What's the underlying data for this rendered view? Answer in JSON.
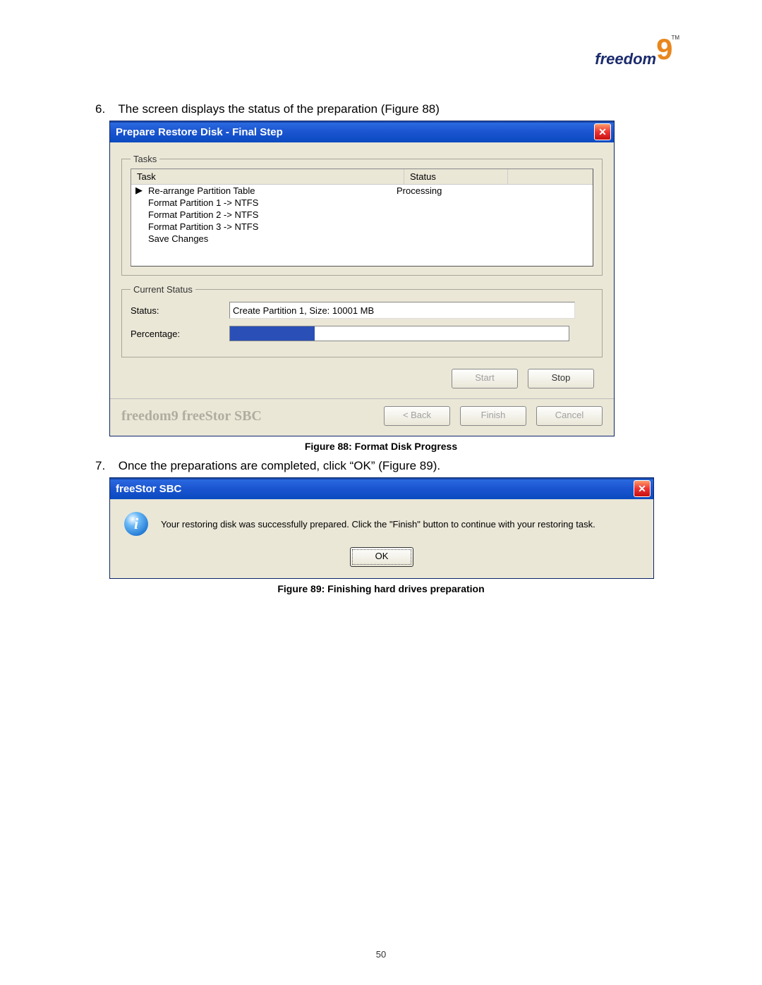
{
  "page_number": "50",
  "logo": {
    "text": "freedom",
    "nine": "9",
    "tm": "TM"
  },
  "step6": {
    "num": "6.",
    "text": "The screen displays the status of the preparation (Figure 88)"
  },
  "dialog1": {
    "title": "Prepare Restore Disk - Final Step",
    "tasks_legend": "Tasks",
    "header": {
      "task": "Task",
      "status": "Status"
    },
    "rows": [
      {
        "marker": "▶",
        "task": "Re-arrange Partition Table",
        "status": "Processing"
      },
      {
        "marker": "",
        "task": "Format Partition 1 -> NTFS",
        "status": ""
      },
      {
        "marker": "",
        "task": "Format Partition 2 -> NTFS",
        "status": ""
      },
      {
        "marker": "",
        "task": "Format Partition 3 -> NTFS",
        "status": ""
      },
      {
        "marker": "",
        "task": "Save Changes",
        "status": ""
      }
    ],
    "currentstatus_legend": "Current Status",
    "status_label": "Status:",
    "status_value": "Create Partition 1, Size: 10001 MB",
    "percentage_label": "Percentage:",
    "buttons": {
      "start": "Start",
      "stop": "Stop"
    },
    "brand": "freedom9 freeStor SBC",
    "footer_buttons": {
      "back": "< Back",
      "finish": "Finish",
      "cancel": "Cancel"
    }
  },
  "caption1": "Figure 88: Format Disk Progress",
  "step7": {
    "num": "7.",
    "text": "Once the preparations are completed, click “OK” (Figure 89)."
  },
  "dialog2": {
    "title": "freeStor SBC",
    "message": "Your restoring disk was successfully prepared. Click the \"Finish\" button to continue with your restoring task.",
    "ok": "OK"
  },
  "caption2": "Figure 89: Finishing hard drives preparation"
}
